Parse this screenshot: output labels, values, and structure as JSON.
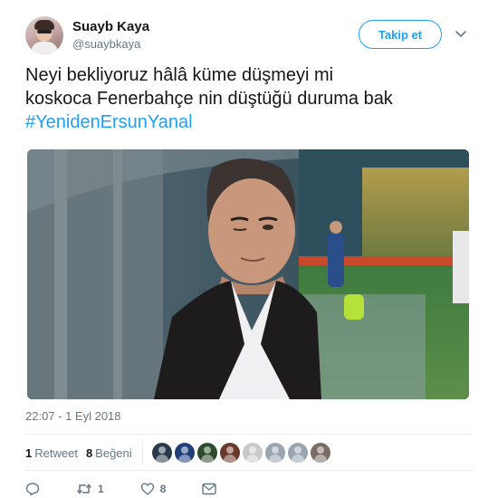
{
  "user": {
    "display_name": "Suayb Kaya",
    "handle": "@suaybkaya",
    "follow_label": "Takip et"
  },
  "tweet": {
    "text_line1": "Neyi bekliyoruz hâlâ küme düşmeyi mi",
    "text_line2": "koskoca Fenerbahçe nin düştüğü duruma bak",
    "hashtag": "#YenidenErsunYanal",
    "timestamp": "22:07 - 1 Eyl 2018"
  },
  "stats": {
    "retweet_count": "1",
    "retweet_label": "Retweet",
    "like_count": "8",
    "like_label": "Beğeni",
    "liker_colors": [
      "#2b3a4a",
      "#1f3f7a",
      "#2c4a2c",
      "#6b3a2a",
      "#c9c9c9",
      "#9aa5b1",
      "#9aa5b1",
      "#7a6e66"
    ]
  },
  "actions": {
    "reply_icon": "reply-icon",
    "retweet_icon": "retweet-icon",
    "retweet_count": "1",
    "like_icon": "heart-icon",
    "like_count": "8",
    "dm_icon": "envelope-icon"
  },
  "colors": {
    "accent": "#1da1f2",
    "text": "#14171a",
    "muted": "#657786",
    "divider": "#e6ecf0"
  }
}
